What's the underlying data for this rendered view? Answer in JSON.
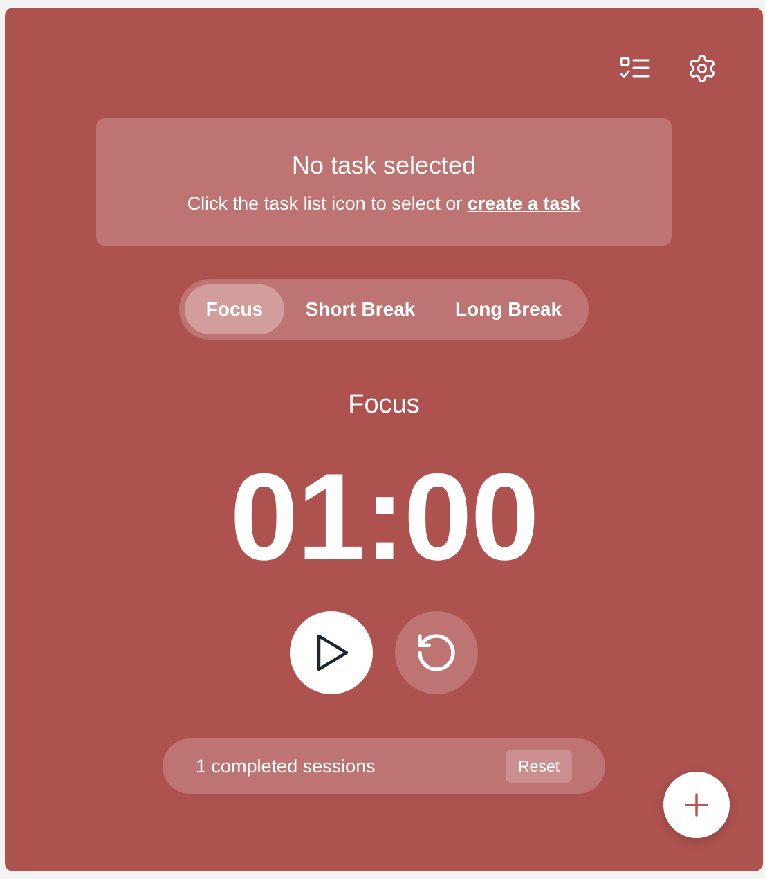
{
  "colors": {
    "background": "#ad524f",
    "text": "#ffffff",
    "play_icon": "#1f2633",
    "fab_icon": "#c0524f"
  },
  "header": {
    "task_list_icon": "task-list-icon",
    "settings_icon": "gear-icon"
  },
  "task": {
    "title": "No task selected",
    "hint_prefix": "Click the task list icon to select or ",
    "hint_link": "create a task"
  },
  "modes": {
    "items": [
      {
        "label": "Focus",
        "active": true
      },
      {
        "label": "Short Break",
        "active": false
      },
      {
        "label": "Long Break",
        "active": false
      }
    ]
  },
  "timer": {
    "mode_label": "Focus",
    "time": "01:00"
  },
  "controls": {
    "play_icon": "play-icon",
    "reset_icon": "restart-icon"
  },
  "sessions": {
    "text": "1 completed sessions",
    "reset_label": "Reset"
  },
  "fab": {
    "icon": "plus-icon"
  }
}
